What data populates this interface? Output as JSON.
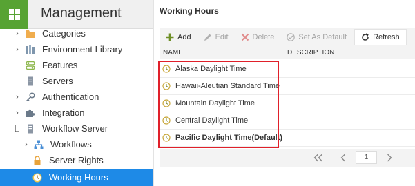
{
  "app": {
    "title": "Management"
  },
  "sidebar": {
    "items": [
      {
        "label": "Categories",
        "icon": "folder-icon",
        "expandable": true
      },
      {
        "label": "Environment Library",
        "icon": "library-icon",
        "expandable": true
      },
      {
        "label": "Features",
        "icon": "features-icon",
        "expandable": false
      },
      {
        "label": "Servers",
        "icon": "server-icon",
        "expandable": false
      },
      {
        "label": "Authentication",
        "icon": "key-icon",
        "expandable": true
      },
      {
        "label": "Integration",
        "icon": "puzzle-icon",
        "expandable": true
      },
      {
        "label": "Workflow Server",
        "icon": "workflow-server-icon",
        "expanded": true
      },
      {
        "label": "Workflows",
        "icon": "workflow-icon",
        "expandable": true
      },
      {
        "label": "Server Rights",
        "icon": "lock-icon",
        "expandable": false
      },
      {
        "label": "Working Hours",
        "icon": "clock-icon",
        "expandable": false,
        "active": true
      }
    ]
  },
  "page": {
    "title": "Working Hours"
  },
  "toolbar": {
    "add": "Add",
    "edit": "Edit",
    "delete": "Delete",
    "set_default": "Set As Default",
    "refresh": "Refresh"
  },
  "grid": {
    "columns": {
      "name": "NAME",
      "description": "DESCRIPTION"
    },
    "rows": [
      {
        "name": "Alaska Daylight Time",
        "description": ""
      },
      {
        "name": "Hawaii-Aleutian Standard Time",
        "description": ""
      },
      {
        "name": "Mountain Daylight Time",
        "description": ""
      },
      {
        "name": "Central Daylight Time",
        "description": ""
      },
      {
        "name": "Pacific Daylight Time(Default)",
        "description": "",
        "default": true
      }
    ]
  },
  "pager": {
    "page": "1"
  },
  "colors": {
    "accent": "#1e8ae7",
    "brand_green": "#57a333",
    "highlight": "#e0202a",
    "folder": "#f0ad4e"
  }
}
